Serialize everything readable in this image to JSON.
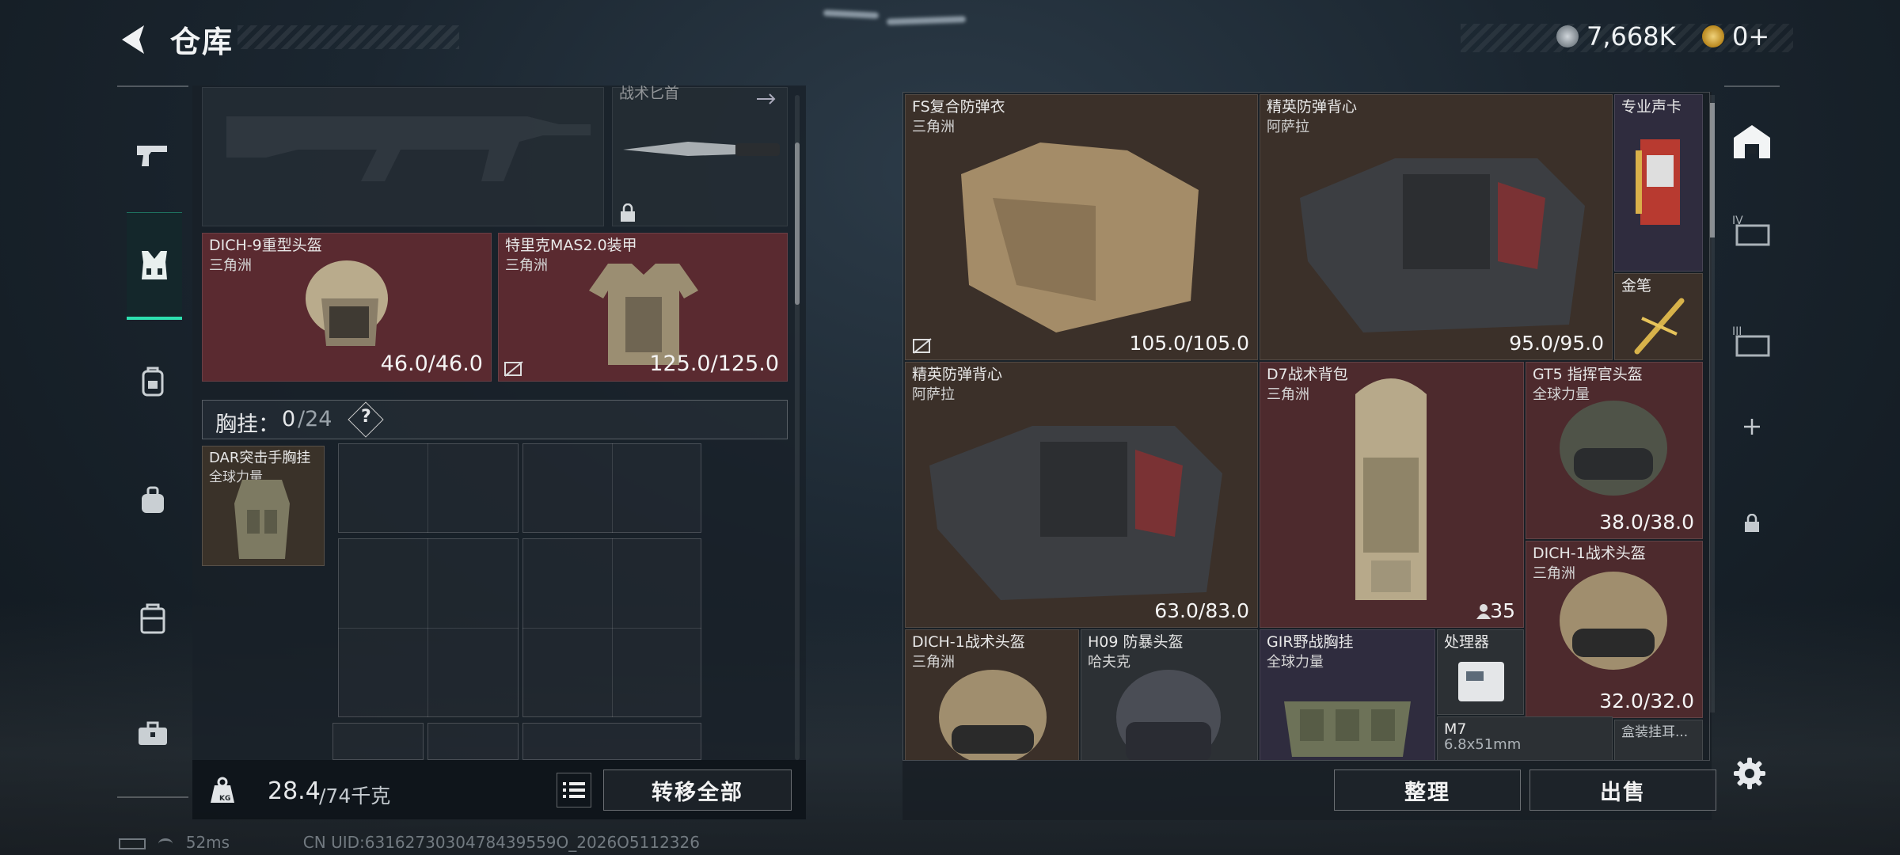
{
  "header": {
    "title": "仓库",
    "back_icon": "back-arrow-icon",
    "currency": [
      {
        "icon": "hafbucks-coin-icon",
        "value": "7,668K",
        "color": "#9aa3ab"
      },
      {
        "icon": "delta-coin-icon",
        "value": "0+",
        "color": "#c9a227"
      }
    ]
  },
  "left_nav": {
    "items": [
      {
        "icon": "pistol-icon",
        "label": "weapons"
      },
      {
        "icon": "vest-icon",
        "label": "armor",
        "active": true
      },
      {
        "icon": "backpack-icon",
        "label": "backpack"
      },
      {
        "icon": "pouch-icon",
        "label": "pouch"
      },
      {
        "icon": "case-icon",
        "label": "container"
      },
      {
        "icon": "toolbox-icon",
        "label": "tools"
      }
    ]
  },
  "loadout": {
    "knife_header": "战术匕首",
    "helmet": {
      "name": "DICH-9重型头盔",
      "faction": "三角洲",
      "durability": "46.0/46.0"
    },
    "armor": {
      "name": "特里克MAS2.0装甲",
      "faction": "三角洲",
      "durability": "125.0/125.0"
    },
    "chest_rig": {
      "label": "胸挂：",
      "used": "0",
      "capacity": "/24",
      "help": "?",
      "item_name": "DAR突击手胸挂",
      "item_sub": "全球力量"
    }
  },
  "footer": {
    "weight_current": "28.4",
    "weight_max": "/74千克",
    "weight_icon_label": "KG",
    "transfer_all": "转移全部",
    "sort": "整理",
    "sell": "出售"
  },
  "stash": {
    "items": [
      {
        "name": "FS复合防弹衣",
        "sub": "三角洲",
        "durability": "105.0/105.0",
        "color": "brown"
      },
      {
        "name": "精英防弹背心",
        "sub": "阿萨拉",
        "durability": "95.0/95.0",
        "color": "brown"
      },
      {
        "name": "专业声卡",
        "sub": "",
        "color": "purple"
      },
      {
        "name": "金笔",
        "sub": "",
        "color": "brown"
      },
      {
        "name": "精英防弹背心",
        "sub": "阿萨拉",
        "durability": "63.0/83.0",
        "color": "brown"
      },
      {
        "name": "D7战术背包",
        "sub": "三角洲",
        "durability": "35",
        "color": "red"
      },
      {
        "name": "GT5 指挥官头盔",
        "sub": "全球力量",
        "durability": "38.0/38.0",
        "color": "red"
      },
      {
        "name": "DICH-1战术头盔",
        "sub": "三角洲",
        "durability": "32.0/32.0",
        "color": "red"
      },
      {
        "name": "DICH-1战术头盔",
        "sub": "三角洲",
        "color": "brown"
      },
      {
        "name": "H09 防暴头盔",
        "sub": "哈夫克",
        "color": "gray"
      },
      {
        "name": "GIR野战胸挂",
        "sub": "全球力量",
        "color": "purple"
      },
      {
        "name": "处理器",
        "sub": "",
        "color": "gray"
      },
      {
        "name": "M7",
        "sub": "6.8x51mm",
        "color": "gray"
      },
      {
        "name": "盒装挂耳...",
        "sub": "",
        "color": "gray"
      }
    ]
  },
  "right_nav": {
    "items": [
      "stash-main-icon",
      "stash-tab-iv-icon",
      "stash-tab-iii-icon",
      "add-tab-icon",
      "lock-icon"
    ]
  },
  "status": {
    "ping": "52ms",
    "uid": "CN UID:6316273030478439559O_2026O5112326"
  },
  "settings_icon": "gear-icon"
}
